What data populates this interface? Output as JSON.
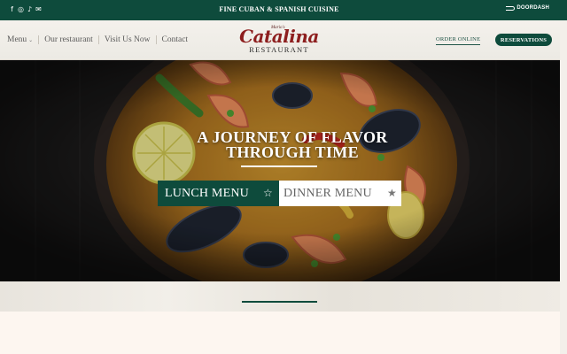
{
  "topbar": {
    "social_icons": [
      "facebook-icon",
      "instagram-icon",
      "tiktok-icon",
      "email-icon"
    ],
    "social_glyphs": [
      "f",
      "◎",
      "♪",
      "✉"
    ],
    "tagline": "FINE CUBAN & SPANISH CUISINE",
    "doordash_label": "DOORDASH",
    "bg_color": "#0e4b3c"
  },
  "nav": {
    "items": [
      {
        "label": "Menu",
        "has_dropdown": true
      },
      {
        "label": "Our restaurant"
      },
      {
        "label": "Visit Us Now"
      },
      {
        "label": "Contact"
      }
    ],
    "caret": "⌄"
  },
  "logo": {
    "small_text": "Mario's",
    "script_text": "Catalina",
    "subtitle": "RESTAURANT",
    "color": "#8d1e1e"
  },
  "header_actions": {
    "order_online": "ORDER ONLINE",
    "reservations": "RESERVATIONS"
  },
  "hero": {
    "headline_line1": "A JOURNEY OF FLAVOR",
    "headline_line2": "THROUGH TIME",
    "lunch_menu": "LUNCH MENU",
    "dinner_menu": "DINNER MENU",
    "star_outline": "☆",
    "star_filled": "★"
  },
  "colors": {
    "brand_green": "#0e4b3c",
    "brand_red": "#8d1e1e",
    "page_bg": "#fdf6f0"
  }
}
